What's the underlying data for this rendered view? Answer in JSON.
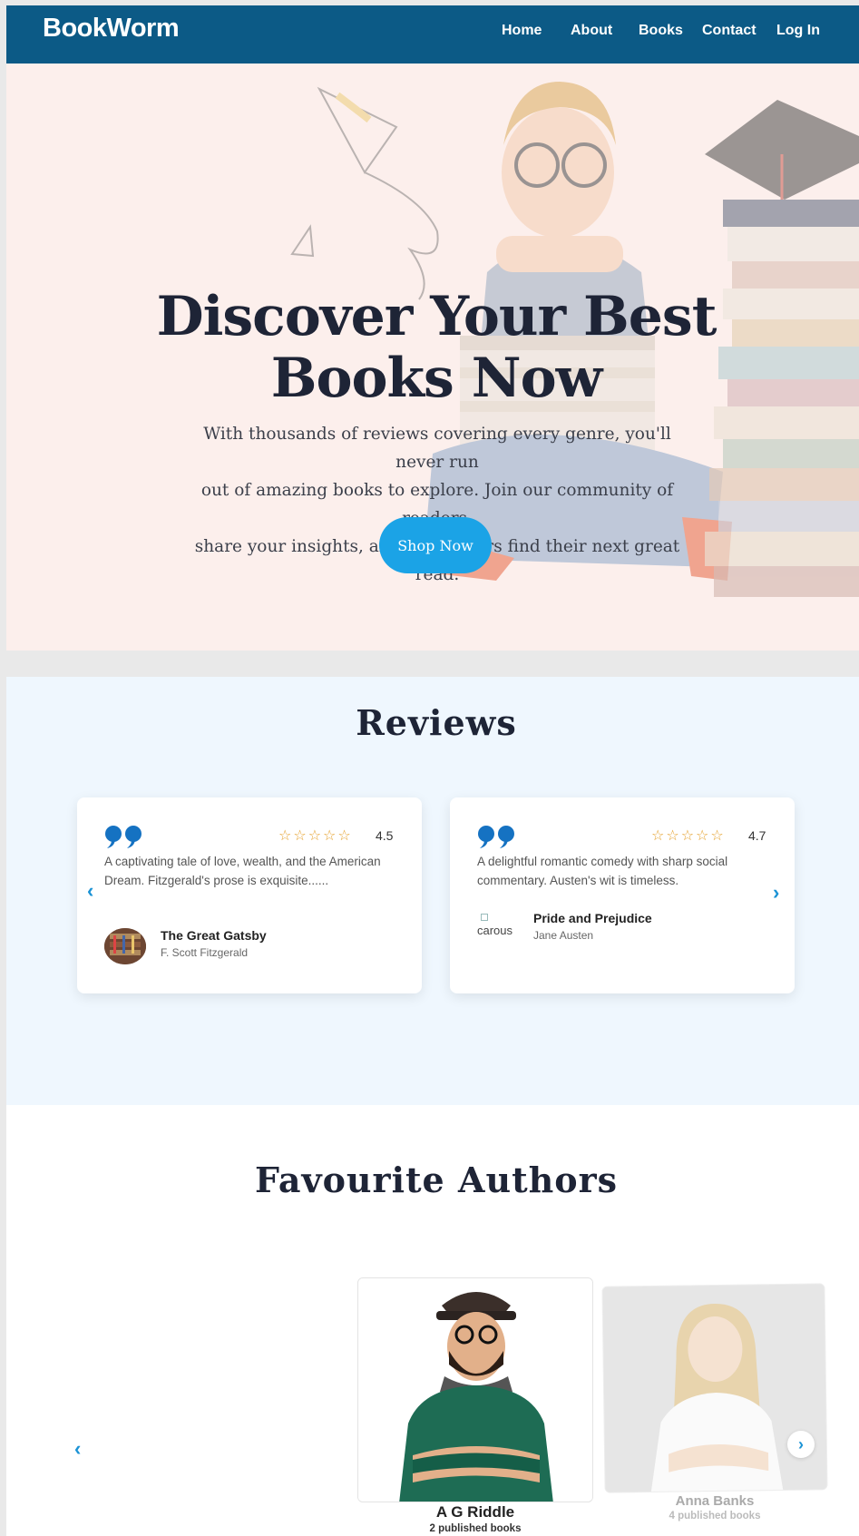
{
  "nav": {
    "brand": "BookWorm",
    "links": [
      "Home",
      "About",
      "Books",
      "Contact",
      "Log In"
    ]
  },
  "hero": {
    "title_line1": "Discover Your Best",
    "title_line2": "Books Now",
    "text_line1": "With thousands of reviews covering every genre, you'll never run",
    "text_line2": "out of amazing books to explore. Join our community of readers,",
    "text_line3": "share your insights, and help others find their next great read.",
    "button": "Shop Now"
  },
  "reviews": {
    "title": "Reviews",
    "items": [
      {
        "stars": "☆☆☆☆☆",
        "rating": "4.5",
        "text": "A captivating tale of love, wealth, and the American Dream. Fitzgerald's prose is exquisite......",
        "book": "The Great Gatsby",
        "author": "F. Scott Fitzgerald"
      },
      {
        "stars": "☆☆☆☆☆",
        "rating": "4.7",
        "text": "A delightful romantic comedy with sharp social commentary. Austen's wit is timeless.",
        "image_alt": "carous",
        "book": "Pride and Prejudice",
        "author": "Jane Austen"
      }
    ],
    "prev_icon": "chevron-left-icon",
    "next_icon": "chevron-right-icon"
  },
  "authors": {
    "title": "Favourite Authors",
    "items": [
      {
        "name": "A G Riddle",
        "books": "2 published books"
      },
      {
        "name": "Anna Banks",
        "books": "4 published books"
      }
    ]
  },
  "colors": {
    "nav_bg": "#0c5a86",
    "accent": "#1ba3e6",
    "star": "#e5a02a",
    "heading": "#1e2436",
    "reviews_bg": "#eff7fe"
  }
}
